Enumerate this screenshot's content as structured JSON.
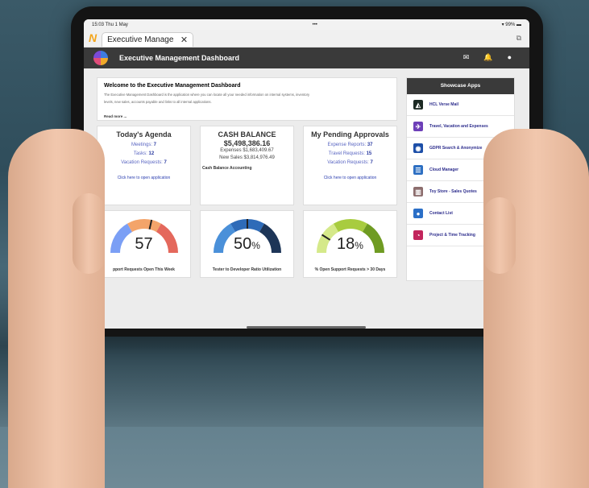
{
  "status": {
    "time": "15:03  Thu 1 May",
    "dots": "•••",
    "battery": "99%"
  },
  "browser": {
    "tab_title": "Executive Manage",
    "brand_glyph": "N"
  },
  "app": {
    "title": "Executive Management Dashboard"
  },
  "welcome": {
    "title": "Welcome to the Executive Management Dashboard",
    "body_line1": "The Executive Management Dashboard is the application where you can locate all your needed information on internal systems, inventory",
    "body_line2": "levels, new sales, accounts payable and links to all internal applications.",
    "read_more": "Read more ..."
  },
  "agenda": {
    "title": "Today's Agenda",
    "meetings_label": "Meetings:",
    "meetings": "7",
    "tasks_label": "Tasks:",
    "tasks": "12",
    "vacation_label": "Vacation Requests:",
    "vacation": "7",
    "link": "Click here to open application"
  },
  "cash": {
    "title": "CASH BALANCE",
    "amount": "$5,498,386.16",
    "expenses": "Expenses $1,683,409.67",
    "sales": "New Sales $3,814,976.49",
    "link": "Cash Balance Accounting"
  },
  "approvals": {
    "title": "My Pending Approvals",
    "expense_label": "Expense Reports:",
    "expense": "37",
    "travel_label": "Travel Requests:",
    "travel": "15",
    "vacation_label": "Vacation Requests:",
    "vacation": "7",
    "link": "Click here to open application"
  },
  "gauges": [
    {
      "value": "57",
      "unit": "",
      "caption": "pport Requests Open This Week",
      "colors": [
        "#7b9ff5",
        "#f3a46a",
        "#e4685c"
      ],
      "level": 0.57
    },
    {
      "value": "50",
      "unit": "%",
      "caption": "Tester to Developer Ratio Utilization",
      "colors": [
        "#4a90d9",
        "#2e6bb8",
        "#1d3557"
      ],
      "level": 0.5
    },
    {
      "value": "18",
      "unit": "%",
      "caption": "% Open Support Requests > 30 Days",
      "colors": [
        "#d5e98a",
        "#a8cc3f",
        "#6f9b22"
      ],
      "level": 0.18
    }
  ],
  "showcase": {
    "title": "Showcase Apps",
    "items": [
      {
        "label": "HCL Verse Mail",
        "icon": "verse-icon",
        "color": "#1c2a24"
      },
      {
        "label": "Travel, Vacation and Expenses",
        "icon": "plane-icon",
        "color": "#6d3fb8"
      },
      {
        "label": "GDPR Search & Anonymize",
        "icon": "gdpr-icon",
        "color": "#1d4fa8"
      },
      {
        "label": "Cloud Manager",
        "icon": "server-icon",
        "color": "#2d6fc2"
      },
      {
        "label": "Toy Store - Sales Quotes",
        "icon": "chart-icon",
        "color": "#8c6d6d"
      },
      {
        "label": "Contact List",
        "icon": "contact-icon",
        "color": "#2b6fc7"
      },
      {
        "label": "Project & Time Tracking",
        "icon": "clock-icon",
        "color": "#c2255c"
      }
    ]
  }
}
